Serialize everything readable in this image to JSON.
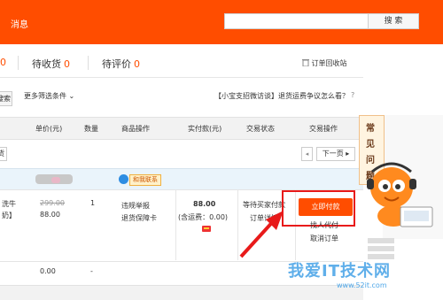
{
  "topbar": {
    "messages": "消息",
    "search_placeholder": "",
    "search_button": "搜 索"
  },
  "tabs": [
    {
      "count": "0"
    },
    {
      "label": "待收货",
      "count": "0"
    },
    {
      "label": "待评价",
      "count": "0"
    }
  ],
  "recycle_label": "订单回收站",
  "filters": {
    "search_stub": "搜索",
    "more_filters": "更多筛选条件 ⌄",
    "dispute_text": "【小宝支招微访谈】退货运费争议怎么看？"
  },
  "table_header": {
    "unit_price": "单价(元)",
    "quantity": "数量",
    "product_ops": "商品操作",
    "paid": "实付款(元)",
    "status": "交易状态",
    "trade_ops": "交易操作"
  },
  "pager": {
    "left_stub": "货",
    "prev": "◂",
    "next": "下一页 ▸"
  },
  "order": {
    "contact_label": "和我联系",
    "item_name_1": "洗牛",
    "item_name_2": "奶】",
    "original_price": "299.00",
    "price": "88.00",
    "quantity": "1",
    "op_1": "违规举报",
    "op_2": "退货保障卡",
    "total": "88.00",
    "shipping": "(含运费：0.00)",
    "status_1": "等待买家付款",
    "status_2": "订单详情",
    "pay_button": "立即付款",
    "proxy_pay": "找人代付",
    "cancel": "取消订单"
  },
  "row2": {
    "price": "0.00",
    "dash": "-"
  },
  "sidebar": {
    "chars": [
      "常",
      "见",
      "问",
      "题"
    ]
  },
  "watermark": {
    "main": "我爱IT技术网",
    "sub": "www.52it.com"
  },
  "colors": {
    "brand": "#ff4d00",
    "highlight": "#e81a1a",
    "arrow": "#e81a1a"
  }
}
